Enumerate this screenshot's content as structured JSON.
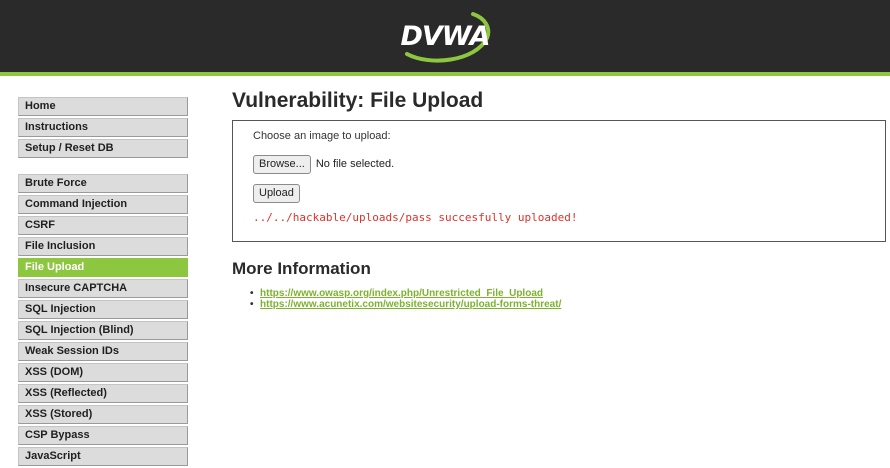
{
  "header": {
    "logo_text": "DVWA",
    "brand_color": "#8dc63f",
    "background_color": "#2a2a2a"
  },
  "sidebar": {
    "group1": [
      {
        "label": "Home"
      },
      {
        "label": "Instructions"
      },
      {
        "label": "Setup / Reset DB"
      }
    ],
    "group2": [
      {
        "label": "Brute Force"
      },
      {
        "label": "Command Injection"
      },
      {
        "label": "CSRF"
      },
      {
        "label": "File Inclusion"
      },
      {
        "label": "File Upload",
        "selected": true
      },
      {
        "label": "Insecure CAPTCHA"
      },
      {
        "label": "SQL Injection"
      },
      {
        "label": "SQL Injection (Blind)"
      },
      {
        "label": "Weak Session IDs"
      },
      {
        "label": "XSS (DOM)"
      },
      {
        "label": "XSS (Reflected)"
      },
      {
        "label": "XSS (Stored)"
      },
      {
        "label": "CSP Bypass"
      },
      {
        "label": "JavaScript"
      }
    ]
  },
  "main": {
    "title": "Vulnerability: File Upload",
    "upload_form": {
      "choose_label": "Choose an image to upload:",
      "browse_label": "Browse...",
      "file_status": "No file selected.",
      "upload_label": "Upload",
      "message": "../../hackable/uploads/pass succesfully uploaded!",
      "message_color": "#e0312a"
    },
    "more_info": {
      "heading": "More Information",
      "links": [
        "https://www.owasp.org/index.php/Unrestricted_File_Upload",
        "https://www.acunetix.com/websitesecurity/upload-forms-threat/"
      ]
    }
  }
}
